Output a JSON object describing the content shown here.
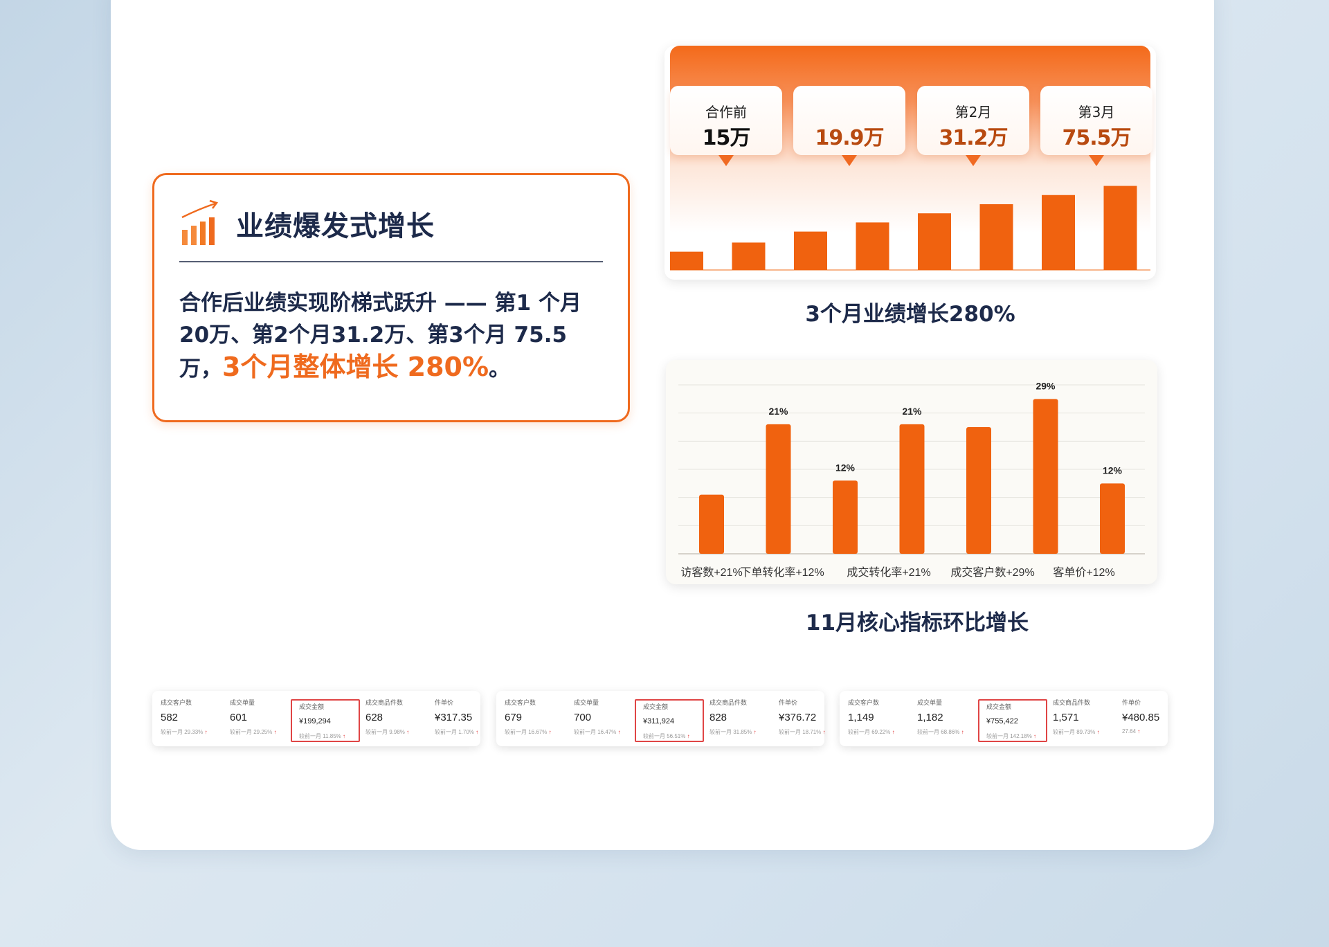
{
  "growth": {
    "title": "业绩爆发式增长",
    "desc_main": "合作后业绩实现阶梯式跃升 —— 第1 个月20万、第2个月31.2万、第3个月 75.5 万，",
    "desc_highlight": "3个月整体增长 280%",
    "desc_end": "。"
  },
  "colors": {
    "accent": "#ef6a1e",
    "navy": "#1d2a4a",
    "bar": "#f0620f"
  },
  "chart_data": [
    {
      "type": "bar",
      "title": "3个月业绩增长280%",
      "milestones": [
        {
          "label": "合作前",
          "value": "15万"
        },
        {
          "label": "",
          "value": "19.9万"
        },
        {
          "label": "第2月",
          "value": "31.2万"
        },
        {
          "label": "第3月",
          "value": "75.5万"
        }
      ],
      "values": [
        1,
        1.5,
        2.1,
        2.6,
        3.1,
        3.6,
        4.1,
        4.6
      ],
      "ylim": [
        0,
        5
      ],
      "grid": false
    },
    {
      "type": "bar",
      "title": "11月核心指标环比增长",
      "categories": [
        "访客数+21%",
        "",
        "下单转化率+12%",
        "",
        "成交转化率+21%",
        "",
        "成交客户数+29%",
        "客单价+12%"
      ],
      "values": [
        21,
        46,
        26,
        46,
        45,
        55,
        25
      ],
      "data_labels": [
        "",
        "21%",
        "12%",
        "21%",
        "",
        "29%",
        "12%"
      ],
      "ylim": [
        0,
        60
      ],
      "grid": true
    }
  ],
  "stats": [
    {
      "items": [
        {
          "label": "成交客户数",
          "value": "582",
          "compare": "较前一月 29.33%"
        },
        {
          "label": "成交单量",
          "value": "601",
          "compare": "较前一月 29.25%"
        },
        {
          "label": "成交金额",
          "value": "¥199,294",
          "compare": "较前一月 11.85%",
          "highlight": true
        },
        {
          "label": "成交商品件数",
          "value": "628",
          "compare": "较前一月 9.98%"
        },
        {
          "label": "件单价",
          "value": "¥317.35",
          "compare": "较前一月 1.70%"
        }
      ]
    },
    {
      "items": [
        {
          "label": "成交客户数",
          "value": "679",
          "compare": "较前一月 16.67%"
        },
        {
          "label": "成交单量",
          "value": "700",
          "compare": "较前一月 16.47%"
        },
        {
          "label": "成交金额",
          "value": "¥311,924",
          "compare": "较前一月 56.51%",
          "highlight": true
        },
        {
          "label": "成交商品件数",
          "value": "828",
          "compare": "较前一月 31.85%"
        },
        {
          "label": "件单价",
          "value": "¥376.72",
          "compare": "较前一月 18.71%"
        }
      ]
    },
    {
      "items": [
        {
          "label": "成交客户数",
          "value": "1,149",
          "compare": "较前一月 69.22%"
        },
        {
          "label": "成交单量",
          "value": "1,182",
          "compare": "较前一月 68.86%"
        },
        {
          "label": "成交金额",
          "value": "¥755,422",
          "compare": "较前一月 142.18%",
          "highlight": true
        },
        {
          "label": "成交商品件数",
          "value": "1,571",
          "compare": "较前一月 89.73%"
        },
        {
          "label": "件单价",
          "value": "¥480.85",
          "compare": "27.64"
        }
      ]
    }
  ]
}
